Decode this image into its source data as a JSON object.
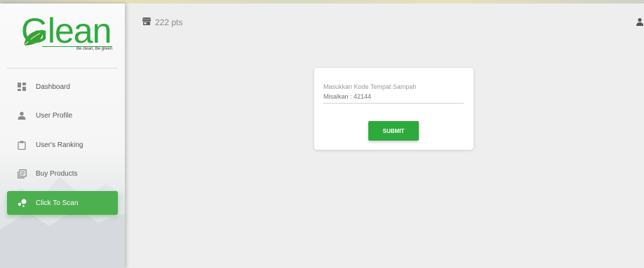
{
  "brand": {
    "logo_text": "Glean",
    "tagline": "Be clean, Be green",
    "color": "#2eaa3c"
  },
  "sidebar": {
    "items": [
      {
        "label": "Dashboard",
        "icon": "dashboard-icon",
        "active": false
      },
      {
        "label": "User Profile",
        "icon": "person-icon",
        "active": false
      },
      {
        "label": "User's Ranking",
        "icon": "clipboard-icon",
        "active": false
      },
      {
        "label": "Buy Products",
        "icon": "library-books-icon",
        "active": false
      },
      {
        "label": "Click To Scan",
        "icon": "bubble-chart-icon",
        "active": true
      }
    ],
    "active_color": "#4caf50"
  },
  "header": {
    "points_label": "222 pts",
    "points_icon": "store-icon",
    "user_icon": "person-icon"
  },
  "scan_card": {
    "field_label": "Masukkan Kode Tempat Sampah",
    "input_value": "",
    "input_placeholder": "Misalkan : 42144",
    "submit_label": "SUBMIT"
  }
}
